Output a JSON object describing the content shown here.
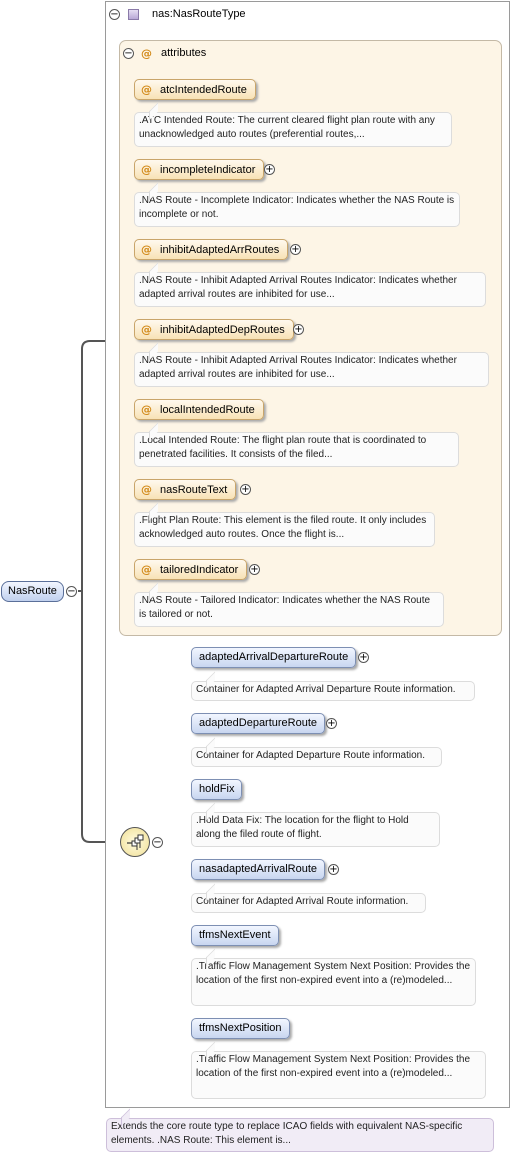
{
  "root": {
    "name": "NasRoute",
    "documentation": "Extends the core route type to replace ICAO fields with equivalent NAS-specific elements. .NAS Route: This element is..."
  },
  "type": {
    "name": "nas:NasRouteType"
  },
  "attributes_group": {
    "label": "attributes",
    "icon": "@",
    "items": [
      {
        "name": "atcIntendedRoute",
        "doc": ".ATC Intended Route: The current cleared flight plan route with any unacknowledged auto routes (preferential routes,..."
      },
      {
        "name": "incompleteIndicator",
        "doc": ".NAS Route - Incomplete Indicator: Indicates whether the NAS Route is incomplete or not."
      },
      {
        "name": "inhibitAdaptedArrRoutes",
        "doc": ".NAS Route - Inhibit Adapted Arrival Routes Indicator: Indicates whether adapted arrival routes are inhibited for use..."
      },
      {
        "name": "inhibitAdaptedDepRoutes",
        "doc": ".NAS Route - Inhibit Adapted Arrival Routes Indicator: Indicates whether adapted arrival routes are inhibited for use..."
      },
      {
        "name": "localIntendedRoute",
        "doc": ".Local Intended Route: The flight plan route that is coordinated to penetrated facilities. It consists of the filed..."
      },
      {
        "name": "nasRouteText",
        "doc": ".Flight Plan Route: This element is the filed route. It only includes acknowledged auto routes. Once the flight is..."
      },
      {
        "name": "tailoredIndicator",
        "doc": ".NAS Route - Tailored Indicator: Indicates whether the NAS Route is tailored or not."
      }
    ]
  },
  "sequence": {
    "elements": [
      {
        "name": "adaptedArrivalDepartureRoute",
        "doc": "Container for Adapted Arrival Departure Route information."
      },
      {
        "name": "adaptedDepartureRoute",
        "doc": "Container for Adapted Departure Route information."
      },
      {
        "name": "holdFix",
        "doc": ".Hold Data Fix: The location for the flight to Hold along the filed route of flight."
      },
      {
        "name": "nasadaptedArrivalRoute",
        "doc": "Container for Adapted Arrival Route information."
      },
      {
        "name": "tfmsNextEvent",
        "doc": ".Traffic Flow Management System Next Position: Provides the location of the first non-expired event into a (re)modeled..."
      },
      {
        "name": "tfmsNextPosition",
        "doc": ".Traffic Flow Management System Next Position: Provides the location of the first non-expired event into a (re)modeled..."
      }
    ]
  },
  "symbols": {
    "collapse": "−",
    "expand": "+"
  },
  "colors": {
    "attribute_fill": "#f8e2b5",
    "element_fill": "#c8d6f0",
    "group_background": "#fdf5e6",
    "root_doc_background": "#f1ecf6"
  }
}
